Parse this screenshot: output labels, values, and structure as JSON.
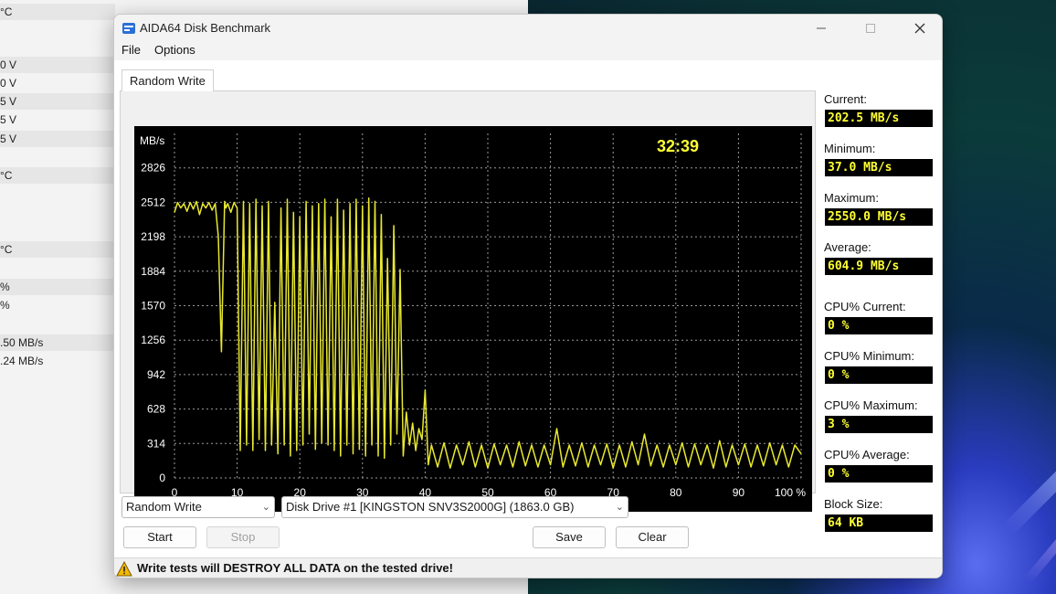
{
  "background_panel": {
    "rows": [
      "°C",
      "0 V",
      "0 V",
      "5 V",
      "5 V",
      "5 V",
      "°C",
      "°C",
      "%",
      "%",
      ".50 MB/s",
      ".24 MB/s"
    ]
  },
  "window": {
    "title": "AIDA64 Disk Benchmark",
    "menu": [
      "File",
      "Options"
    ],
    "tab": "Random Write",
    "warning": "Write tests will DESTROY ALL DATA on the tested drive!"
  },
  "controls": {
    "test_select": "Random Write",
    "drive_select": "Disk Drive #1  [KINGSTON SNV3S2000G]  (1863.0 GB)",
    "start": "Start",
    "stop": "Stop",
    "save": "Save",
    "clear": "Clear"
  },
  "stats": [
    {
      "label": "Current:",
      "value": "202.5 MB/s"
    },
    {
      "label": "Minimum:",
      "value": "37.0 MB/s"
    },
    {
      "label": "Maximum:",
      "value": "2550.0 MB/s"
    },
    {
      "label": "Average:",
      "value": "604.9 MB/s"
    },
    {
      "label": "CPU% Current:",
      "value": "0 %"
    },
    {
      "label": "CPU% Minimum:",
      "value": "0 %"
    },
    {
      "label": "CPU% Maximum:",
      "value": "3 %"
    },
    {
      "label": "CPU% Average:",
      "value": "0 %"
    },
    {
      "label": "Block Size:",
      "value": "64 KB"
    }
  ],
  "chart_data": {
    "type": "line",
    "ylabel": "MB/s",
    "ylim": [
      0,
      3140
    ],
    "y_ticks": [
      "2826",
      "2512",
      "2198",
      "1884",
      "1570",
      "1256",
      "942",
      "628",
      "314",
      "0"
    ],
    "x_ticks": [
      "0",
      "10",
      "20",
      "30",
      "40",
      "50",
      "60",
      "70",
      "80",
      "90",
      "100 %"
    ],
    "xlim": [
      0,
      100
    ],
    "timer": "32:39",
    "grid": true,
    "colors": {
      "line": "#e8e830",
      "grid": "#9a9a9a",
      "background": "#000000",
      "timer": "#ffff33"
    },
    "series": [
      {
        "x": [
          0,
          0.5,
          1,
          1.5,
          2,
          2.5,
          3,
          3.5,
          4,
          4.5,
          5,
          5.5,
          6,
          6.5,
          7,
          7.5,
          8,
          8.2,
          8.5,
          9,
          9.5,
          10,
          10.5,
          11,
          11.5,
          12,
          12.5,
          13,
          13.5,
          14,
          14.5,
          15,
          15.5,
          16,
          16.5,
          17,
          17.5,
          18,
          18.5,
          19,
          19.5,
          20,
          20.5,
          21,
          21.5,
          22,
          22.5,
          23,
          23.5,
          24,
          24.5,
          25,
          25.5,
          26,
          26.5,
          27,
          27.5,
          28,
          28.5,
          29,
          29.5,
          30,
          30.5,
          31,
          31.5,
          32,
          32.5,
          33,
          33.5,
          34,
          34.5,
          35,
          35.5,
          36,
          36.5,
          37,
          37.5,
          38,
          38.5,
          39,
          39.5,
          40,
          40.5,
          41,
          42,
          43,
          44,
          45,
          46,
          47,
          48,
          49,
          50,
          51,
          52,
          53,
          54,
          55,
          56,
          57,
          58,
          59,
          60,
          61,
          62,
          63,
          64,
          65,
          66,
          67,
          68,
          69,
          70,
          71,
          72,
          73,
          74,
          75,
          76,
          77,
          78,
          79,
          80,
          81,
          82,
          83,
          84,
          85,
          86,
          87,
          88,
          89,
          90,
          91,
          92,
          93,
          94,
          95,
          96,
          97,
          98,
          99,
          100
        ],
        "y": [
          2420,
          2510,
          2460,
          2500,
          2430,
          2510,
          2450,
          2520,
          2400,
          2500,
          2460,
          2510,
          2440,
          2500,
          2200,
          1150,
          2520,
          2460,
          2500,
          2420,
          2510,
          2460,
          250,
          2520,
          300,
          2500,
          250,
          2540,
          350,
          2480,
          250,
          2520,
          300,
          1600,
          220,
          2460,
          300,
          2540,
          200,
          2420,
          250,
          2380,
          300,
          2520,
          400,
          2480,
          260,
          2500,
          320,
          2540,
          300,
          2380,
          250,
          2540,
          200,
          2440,
          300,
          2500,
          220,
          2540,
          260,
          2480,
          200,
          2550,
          300,
          2520,
          200,
          2400,
          180,
          2000,
          300,
          2300,
          400,
          1900,
          200,
          600,
          300,
          500,
          250,
          450,
          350,
          800,
          120,
          300,
          100,
          320,
          90,
          300,
          120,
          330,
          100,
          300,
          90,
          310,
          120,
          300,
          100,
          330,
          110,
          300,
          100,
          300,
          120,
          450,
          100,
          300,
          110,
          320,
          100,
          300,
          120,
          310,
          90,
          300,
          100,
          330,
          120,
          400,
          110,
          300,
          100,
          300,
          120,
          320,
          100,
          310,
          120,
          300,
          90,
          340,
          100,
          300,
          120,
          310,
          100,
          300,
          110,
          320,
          120,
          300,
          100,
          300,
          220
        ]
      }
    ]
  }
}
